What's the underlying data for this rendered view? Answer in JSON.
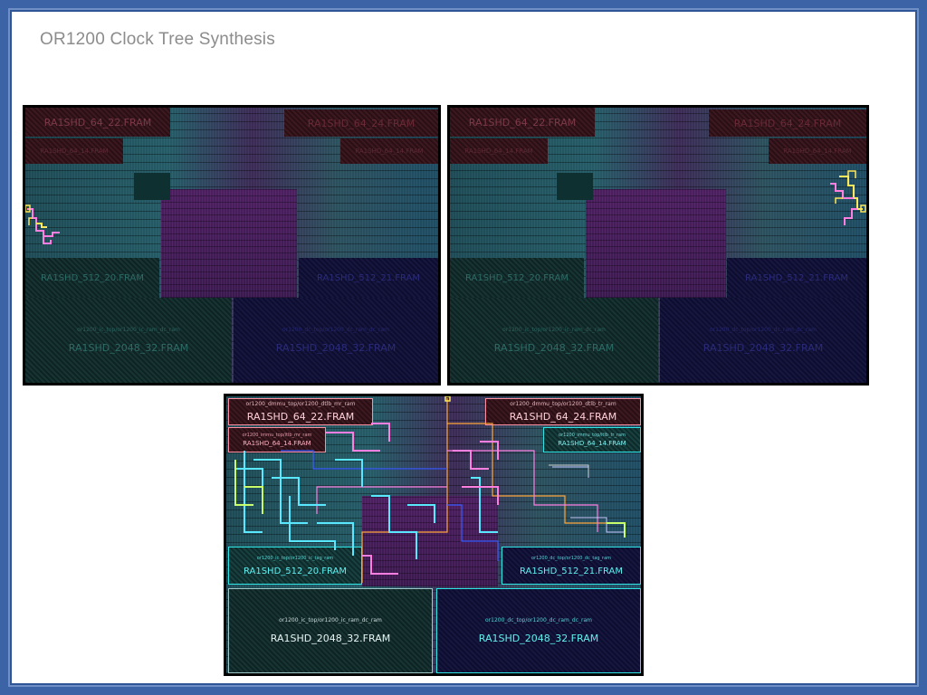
{
  "slide": {
    "title": "OR1200 Clock Tree Synthesis"
  },
  "colors": {
    "frame": "#2f5597",
    "background": "#ffffff",
    "title_text": "#8c8c8c",
    "macro_red": "#ff8fa0",
    "macro_cyan": "#2ee6e6",
    "macro_blue": "#4a4adf",
    "clock_yellow": "#ffe85a",
    "clock_pink": "#ff7fe0",
    "clock_cyan": "#59e8ff",
    "clock_orange": "#ffa53a"
  },
  "panels": [
    {
      "id": "top-left",
      "macros": {
        "m1": {
          "label": "RA1SHD_64_22.FRAM",
          "inst": ""
        },
        "m2": {
          "label": "RA1SHD_64_24.FRAM",
          "inst": ""
        },
        "m3": {
          "label": "RA1SHD_64_14.FRAM",
          "inst": ""
        },
        "m4": {
          "label": "RA1SHD_64_14.FRAM",
          "inst": ""
        },
        "m5": {
          "label": "RA1SHD_512_20.FRAM",
          "inst": ""
        },
        "m6": {
          "label": "RA1SHD_512_21.FRAM",
          "inst": ""
        },
        "m7": {
          "label": "RA1SHD_2048_32.FRAM",
          "inst": "or1200_ic_top/or1200_ic_ram_dc_ram"
        },
        "m8": {
          "label": "RA1SHD_2048_32.FRAM",
          "inst": "or1200_dc_top/or1200_dc_ram_dc_ram"
        }
      }
    },
    {
      "id": "top-right",
      "macros": {
        "m1": {
          "label": "RA1SHD_64_22.FRAM",
          "inst": ""
        },
        "m2": {
          "label": "RA1SHD_64_24.FRAM",
          "inst": ""
        },
        "m3": {
          "label": "RA1SHD_64_14.FRAM",
          "inst": ""
        },
        "m4": {
          "label": "RA1SHD_64_14.FRAM",
          "inst": ""
        },
        "m5": {
          "label": "RA1SHD_512_20.FRAM",
          "inst": ""
        },
        "m6": {
          "label": "RA1SHD_512_21.FRAM",
          "inst": ""
        },
        "m7": {
          "label": "RA1SHD_2048_32.FRAM",
          "inst": "or1200_ic_top/or1200_ic_ram_dc_ram"
        },
        "m8": {
          "label": "RA1SHD_2048_32.FRAM",
          "inst": "or1200_dc_top/or1200_dc_ram_dc_ram"
        }
      }
    },
    {
      "id": "bottom",
      "macros": {
        "m1": {
          "label": "RA1SHD_64_22.FRAM",
          "inst": "or1200_dmmu_top/or1200_dtlb_mr_ram"
        },
        "m2": {
          "label": "RA1SHD_64_24.FRAM",
          "inst": "or1200_dmmu_top/or1200_dtlb_tr_ram"
        },
        "m3": {
          "label": "RA1SHD_64_14.FRAM",
          "inst": "or1200_immu_top/itlb_mr_ram"
        },
        "m4": {
          "label": "RA1SHD_64_14.FRAM",
          "inst": "or1200_immu_top/itlb_tr_ram"
        },
        "m5": {
          "label": "RA1SHD_512_20.FRAM",
          "inst": "or1200_ic_top/or1200_ic_tag_ram"
        },
        "m6": {
          "label": "RA1SHD_512_21.FRAM",
          "inst": "or1200_dc_top/or1200_dc_tag_ram"
        },
        "m7": {
          "label": "RA1SHD_2048_32.FRAM",
          "inst": "or1200_ic_top/or1200_ic_ram_dc_ram"
        },
        "m8": {
          "label": "RA1SHD_2048_32.FRAM",
          "inst": "or1200_dc_top/or1200_dc_ram_dc_ram"
        }
      }
    }
  ]
}
